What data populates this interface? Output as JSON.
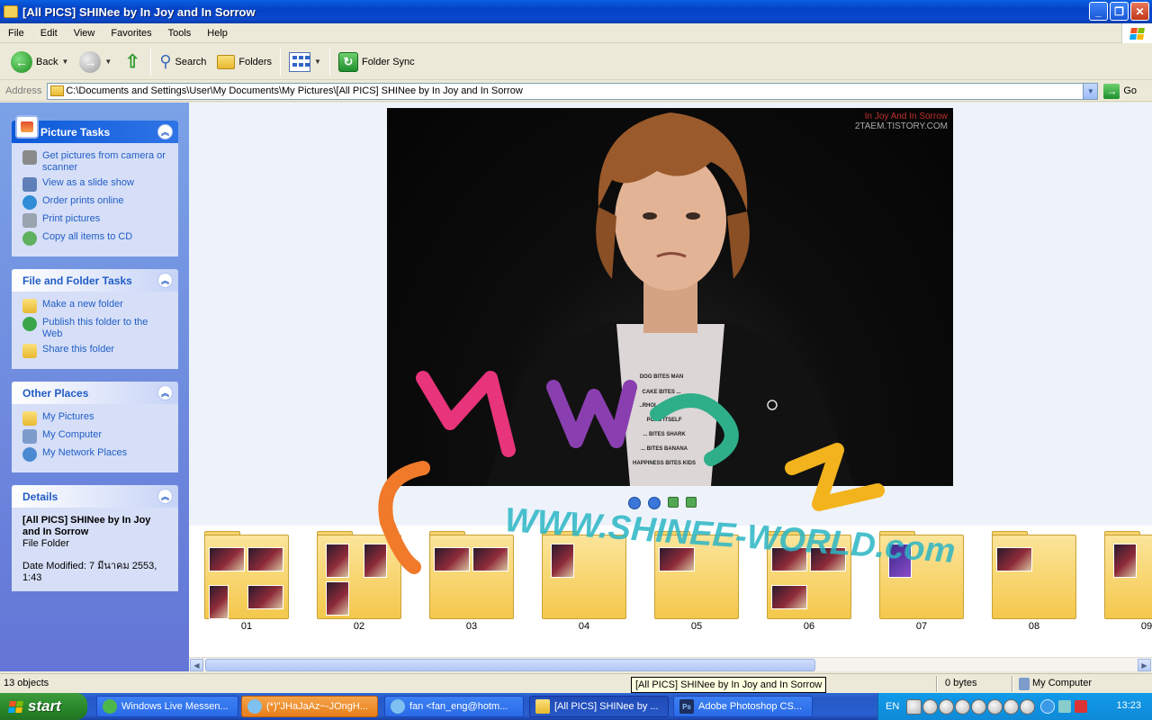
{
  "window": {
    "title": "[All PICS] SHINee by In Joy and In Sorrow"
  },
  "menu": [
    "File",
    "Edit",
    "View",
    "Favorites",
    "Tools",
    "Help"
  ],
  "toolbar": {
    "back": "Back",
    "search": "Search",
    "folders": "Folders",
    "folder_sync": "Folder Sync"
  },
  "address": {
    "label": "Address",
    "path": "C:\\Documents and Settings\\User\\My Documents\\My Pictures\\[All PICS] SHINee by In Joy and In Sorrow",
    "go": "Go"
  },
  "left": {
    "picture_tasks": {
      "title": "Picture Tasks",
      "items": [
        "Get pictures from camera or scanner",
        "View as a slide show",
        "Order prints online",
        "Print pictures",
        "Copy all items to CD"
      ]
    },
    "file_tasks": {
      "title": "File and Folder Tasks",
      "items": [
        "Make a new folder",
        "Publish this folder to the Web",
        "Share this folder"
      ]
    },
    "other_places": {
      "title": "Other Places",
      "items": [
        "My Pictures",
        "My Computer",
        "My Network Places"
      ]
    },
    "details": {
      "title": "Details",
      "name": "[All PICS] SHINee by In Joy and In Sorrow",
      "type": "File Folder",
      "modified": "Date Modified: 7 มีนาคม 2553, 1:43"
    }
  },
  "preview": {
    "watermark_line1": "In Joy And In Sorrow",
    "watermark_line2": "2TAEM.TISTORY.COM",
    "shirt_text": [
      "DOG BITES MAN",
      "CAKE BITES ...",
      "..RHOL ..... CONE",
      "POPS ITSELF",
      "... BITES SHARK",
      "... BITES BANANA",
      "HAPPINESS BITES KIDS"
    ]
  },
  "overlay": {
    "logo": "SNWRN",
    "url": "WWW.SHINEE-WORLD.com"
  },
  "folders": [
    "01",
    "02",
    "03",
    "04",
    "05",
    "06",
    "07",
    "08",
    "09"
  ],
  "status": {
    "objects": "13 objects",
    "tooltip": "[All PICS] SHINee by In Joy and In Sorrow",
    "size": "0 bytes",
    "zone": "My Computer"
  },
  "taskbar": {
    "start": "start",
    "buttons": [
      "Windows Live Messen...",
      "(*)\"JHaJaAz~-JOngH...",
      "fan <fan_eng@hotm...",
      "[All PICS] SHINee by ...",
      "Adobe Photoshop CS..."
    ],
    "lang": "EN",
    "clock": "13:23"
  }
}
